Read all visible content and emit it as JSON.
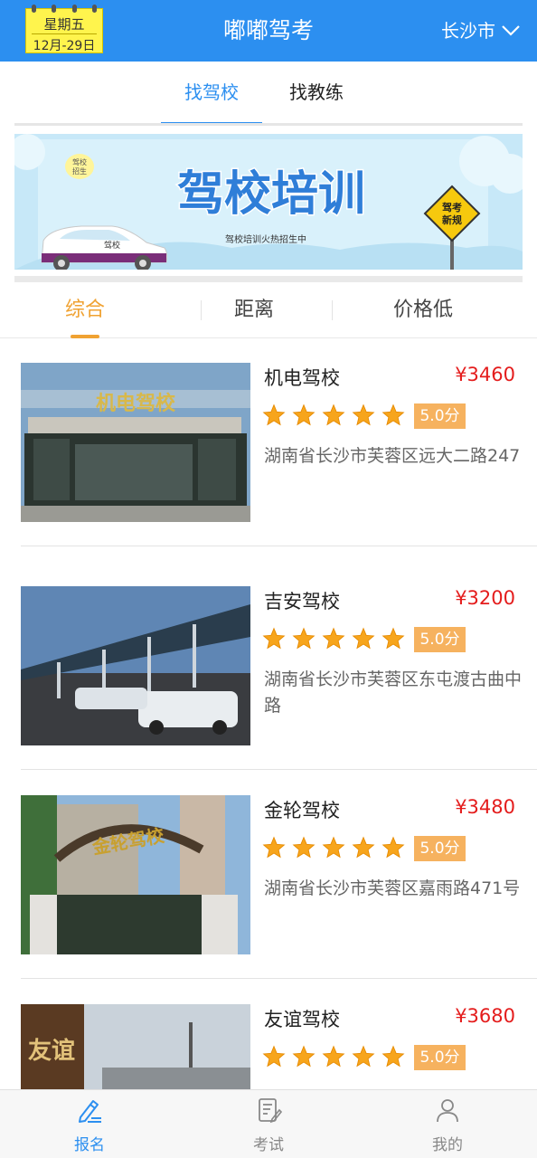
{
  "header": {
    "weekday": "星期五",
    "date": "12月-29日",
    "title": "嘟嘟驾考",
    "city": "长沙市"
  },
  "top_tabs": [
    {
      "label": "找驾校",
      "active": true
    },
    {
      "label": "找教练",
      "active": false
    }
  ],
  "banner": {
    "badge": "驾校招生",
    "headline": "驾校培训",
    "subline": "驾校培训火热招生中",
    "sign": "驾考新规",
    "car_label": "驾校"
  },
  "sort_tabs": [
    {
      "label": "综合",
      "active": true
    },
    {
      "label": "距离",
      "active": false
    },
    {
      "label": "价格低",
      "active": false
    }
  ],
  "schools": [
    {
      "name": "机电驾校",
      "price": "¥3460",
      "rating_stars": 5,
      "score": "5.0分",
      "address": "湖南省长沙市芙蓉区远大二路247",
      "photo_sign": "机电驾校"
    },
    {
      "name": "吉安驾校",
      "price": "¥3200",
      "rating_stars": 5,
      "score": "5.0分",
      "address": "湖南省长沙市芙蓉区东屯渡古曲中路",
      "photo_sign": ""
    },
    {
      "name": "金轮驾校",
      "price": "¥3480",
      "rating_stars": 5,
      "score": "5.0分",
      "address": "湖南省长沙市芙蓉区嘉雨路471号",
      "photo_sign": "金轮驾校"
    },
    {
      "name": "友谊驾校",
      "price": "¥3680",
      "rating_stars": 5,
      "score": "5.0分",
      "address": "",
      "photo_sign": "友谊"
    }
  ],
  "bottom_nav": [
    {
      "label": "报名",
      "icon": "edit-pen-icon",
      "active": true
    },
    {
      "label": "考试",
      "icon": "exam-paper-icon",
      "active": false
    },
    {
      "label": "我的",
      "icon": "user-icon",
      "active": false
    }
  ],
  "colors": {
    "primary": "#2c8ff0",
    "accent_orange": "#f0a232",
    "price_red": "#e41c1c",
    "score_badge": "#f6b25f",
    "date_badge": "#fff44d"
  }
}
